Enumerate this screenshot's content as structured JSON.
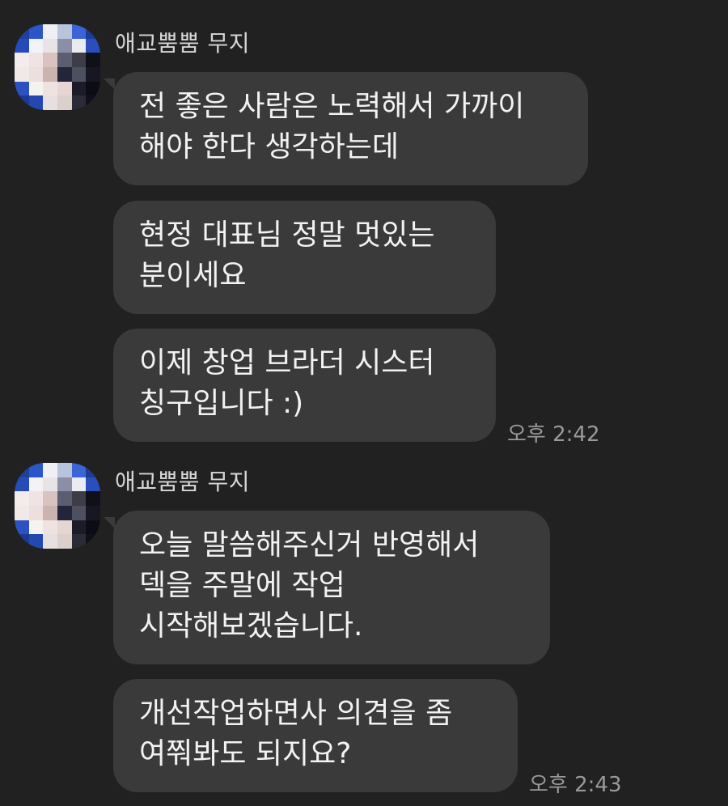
{
  "colors": {
    "background": "#212121",
    "bubble": "#3a3a3a",
    "text": "#f2f2f2",
    "time": "#9a9a9a"
  },
  "groups": [
    {
      "sender": "애교뿜뿜 무지",
      "messages": [
        "전 좋은 사람은 노력해서 가까이\n해야 한다 생각하는데",
        "현정 대표님 정말 멋있는\n분이세요",
        "이제 창업 브라더 시스터\n칭구입니다 :)"
      ],
      "time": "오후 2:42"
    },
    {
      "sender": "애교뿜뿜 무지",
      "messages": [
        "오늘 말씀해주신거 반영해서\n덱을 주말에 작업\n시작해보겠습니다.",
        "개선작업하면사 의견을 좀\n여쭤봐도 되지요?"
      ],
      "time": "오후 2:43"
    }
  ]
}
